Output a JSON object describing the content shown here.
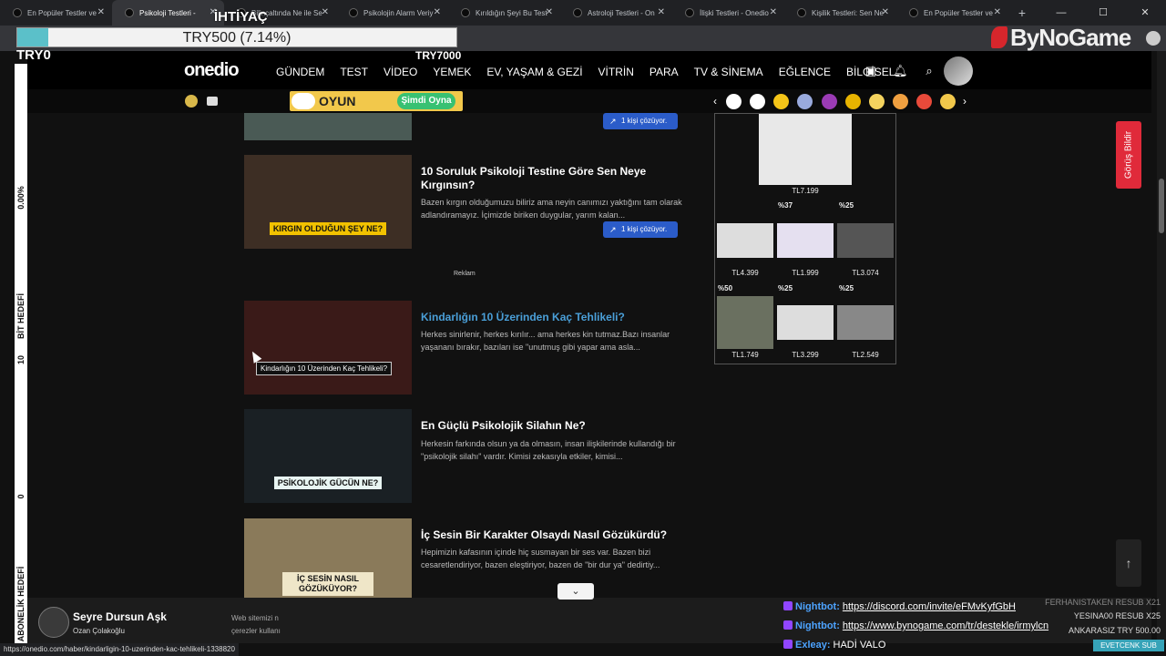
{
  "browser": {
    "tabs": [
      {
        "title": "En Popüler Testler ve"
      },
      {
        "title": "Psikoloji Testleri - "
      },
      {
        "title": "Bilinçaltında Ne ile Se"
      },
      {
        "title": "Psikolojin Alarm Veriy"
      },
      {
        "title": "Kırıldığın Şeyi Bu Test"
      },
      {
        "title": "Astroloji Testleri - On"
      },
      {
        "title": "İlişki Testleri - Onedio"
      },
      {
        "title": "Kişilik Testleri: Sen Ne"
      },
      {
        "title": "En Popüler Testler ve"
      }
    ],
    "new_tab": "+",
    "window_controls": [
      "—",
      "☐",
      "✕"
    ],
    "status_url": "https://onedio.com/haber/kindarligin-10-uzerinden-kac-tehlikeli-1338820"
  },
  "stream": {
    "goal_label": "İHTİYAÇ",
    "goal_text": "TRY500 (7.14%)",
    "goal_progress": 0.0714,
    "left_amount": "TRY0",
    "goal_target": "TRY7000",
    "brand": "ByNoGame",
    "bit_percent": "0.00%",
    "bit_label": "BİT HEDEFİ",
    "bit_value": "10",
    "sub_value": "0",
    "sub_label": "ABONELİK HEDEFİ"
  },
  "site": {
    "logo": "onedio",
    "nav": [
      "GÜNDEM",
      "TEST",
      "VİDEO",
      "YEMEK",
      "EV, YAŞAM & GEZİ",
      "VİTRİN",
      "PARA",
      "TV & SİNEMA",
      "EĞLENCE",
      "BİLGİSEL"
    ],
    "game_banner": {
      "label": "OYUN",
      "play": "Şimdi Oyna",
      "ghost": "onedio"
    },
    "feedback": "Görüş Bildir",
    "to_top": "↑"
  },
  "articles": [
    {
      "title": "",
      "desc": "",
      "caption": "",
      "solving": "1 kişi çözüyor."
    },
    {
      "title": "10 Soruluk Psikoloji Testine Göre Sen Neye Kırgınsın?",
      "desc": "Bazen kırgın olduğumuzu biliriz ama neyin canımızı yaktığını tam olarak adlandıramayız. İçimizde biriken duygular, yarım kalan...",
      "caption": "KIRGIN OLDUĞUN ŞEY NE?",
      "solving": "1 kişi çözüyor."
    },
    {
      "title": "Kindarlığın 10 Üzerinden Kaç Tehlikeli?",
      "desc": "Herkes sinirlenir, herkes kırılır... ama herkes kin tutmaz.Bazı insanlar yaşananı bırakır, bazıları ise \"unutmuş gibi yapar ama asla...",
      "caption": "",
      "solving": ""
    },
    {
      "title": "En Güçlü Psikolojik Silahın Ne?",
      "desc": "Herkesin farkında olsun ya da olmasın, insan ilişkilerinde kullandığı bir \"psikolojik silahı\" vardır. Kimisi zekasıyla etkiler, kimisi...",
      "caption": "PSİKOLOJİK GÜCÜN NE?",
      "solving": ""
    },
    {
      "title": "İç Sesin Bir Karakter Olsaydı Nasıl Gözükürdü?",
      "desc": "Hepimizin kafasının içinde hiç susmayan bir ses var. Bazen bizi cesaretlendiriyor, bazen eleştiriyor, bazen de \"bir dur ya\" dedirtiy...",
      "caption": "İÇ SESİN NASIL GÖZÜKÜYOR?",
      "solving": ""
    }
  ],
  "reklam": "Reklam",
  "tooltip": "Kindarlığın 10 Üzerinden Kaç Tehlikeli?",
  "ad": {
    "top_price": "TL7.199",
    "products": [
      {
        "discount": "%37",
        "price": "TL4.399"
      },
      {
        "discount": "%25",
        "price": "TL1.999"
      },
      {
        "discount": "",
        "price": "TL3.074"
      },
      {
        "discount": "%50",
        "price": "TL1.749"
      },
      {
        "discount": "%25",
        "price": "TL3.299"
      },
      {
        "discount": "%25",
        "price": "TL2.549"
      }
    ]
  },
  "music": {
    "song": "Seyre Dursun Aşk",
    "artist": "Ozan Çolakoğlu"
  },
  "cookie_text": [
    "Web sitemizi n",
    "çerezler kullanı"
  ],
  "chat": [
    {
      "user": "Nightbot:",
      "msg": "https://discord.com/invite/eFMvKyfGbH",
      "link": true
    },
    {
      "user": "Nightbot:",
      "msg": "https://www.bynogame.com/tr/destekle/irmylcn",
      "link": true
    },
    {
      "user": "Exleay:",
      "msg": "HADİ VALO",
      "link": false
    }
  ],
  "events": [
    {
      "name": "FERHANISTAKEN",
      "value": "RESUB X21"
    },
    {
      "name": "YESINA00",
      "value": "RESUB X25"
    },
    {
      "name": "ANKARASIZ",
      "value": "TRY 500.00"
    }
  ],
  "events_button": "EVETCENK SUB",
  "colors": {
    "accent_link": "#4a9fd8",
    "feedback": "#e02a3a",
    "solving": "#2b5cc9",
    "play": "#38c172",
    "brand_red": "#d6262c"
  }
}
